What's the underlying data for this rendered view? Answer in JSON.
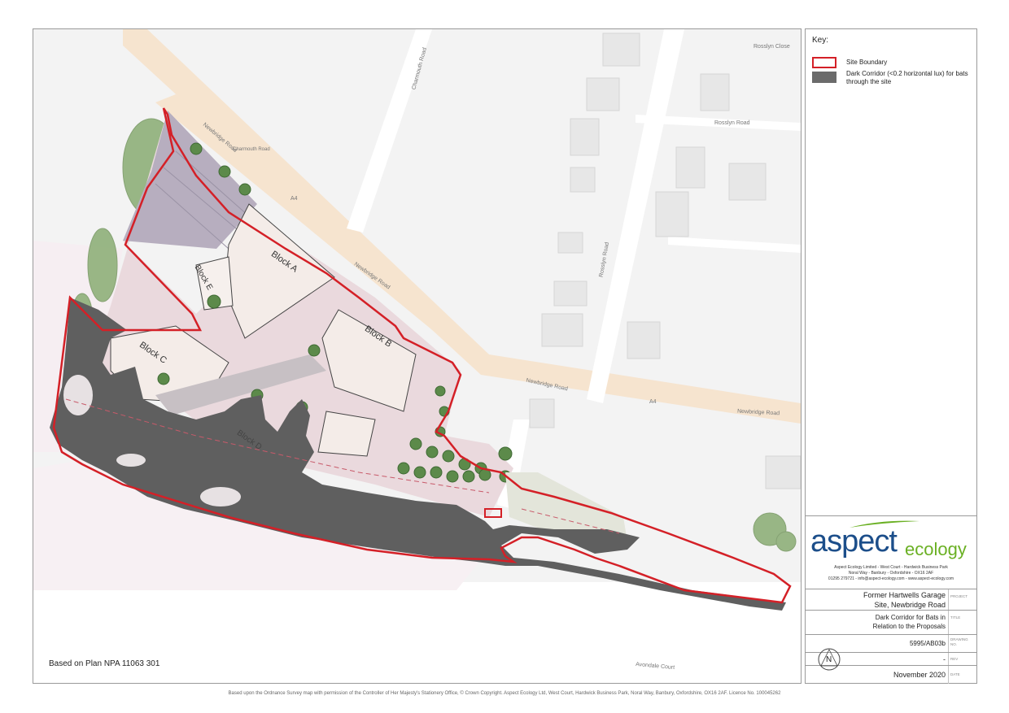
{
  "map": {
    "roads": {
      "newbridge_road_1": "Newbridge Road",
      "newbridge_road_2": "Newbridge Road",
      "newbridge_road_3": "Newbridge Road",
      "newbridge_road_4": "Newbridge Road",
      "a4_1": "A4",
      "a4_2": "A4",
      "charmouth_road": "Charmouth Road",
      "charmouth_road_small": "Charmouth Road",
      "rosslyn_close": "Rosslyn Close",
      "rosslyn_road_1": "Rosslyn Road",
      "rosslyn_road_2": "Rosslyn Road",
      "avondale_court": "Avondale Court"
    },
    "blocks": {
      "block_a": "Block A",
      "block_b": "Block B",
      "block_c": "Block C",
      "block_e": "Block E",
      "block_d": "Block D"
    },
    "plan_note": "Based on Plan NPA 11063 301"
  },
  "key": {
    "title": "Key:",
    "items": [
      {
        "label": "Site Boundary",
        "color": "#d42027"
      },
      {
        "label": "Dark Corridor (<0.2 horizontal lux) for bats through the site",
        "color": "#6b6b6b"
      }
    ]
  },
  "logo": {
    "word1": "aspect",
    "word2": "ecology",
    "address_line1": "Aspect Ecology Limited - West Court - Hardwick Business Park",
    "address_line2": "Noral Way - Banbury - Oxfordshire - OX16 2AF",
    "address_line3": "01295 279721 - info@aspect-ecology.com - www.aspect-ecology.com"
  },
  "titleblock": {
    "project_line1": "Former Hartwells Garage",
    "project_line2": "Site, Newbridge Road",
    "project_label": "PROJECT",
    "title_line1": "Dark Corridor for Bats in",
    "title_line2": "Relation to the Proposals",
    "title_label": "TITLE",
    "drawing_no": "5995/AB03b",
    "drawing_label": "DRAWING NO.",
    "rev": "-",
    "rev_label": "REV",
    "date": "November 2020",
    "date_label": "DATE",
    "north_letter": "N"
  },
  "footer": "Based upon the Ordnance Survey map with permission of the Controller of Her Majesty's Stationery Office, © Crown Copyright. Aspect Ecology Ltd, West Court, Hardwick Business Park, Noral Way, Banbury, Oxfordshire, OX16 2AF. Licence No. 100045262"
}
